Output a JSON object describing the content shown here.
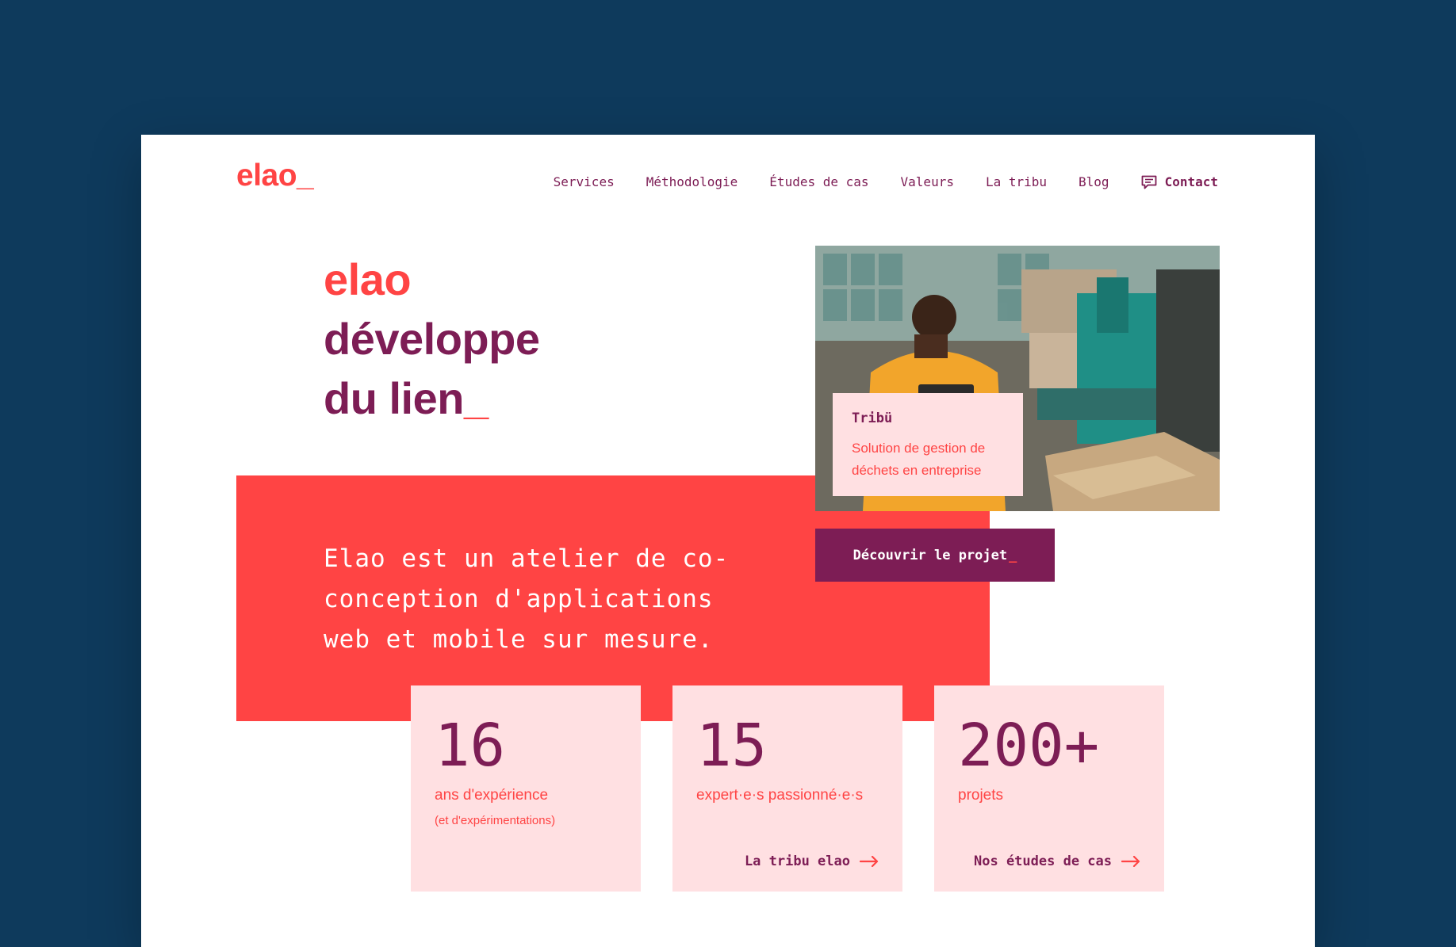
{
  "header": {
    "logo": "elao_",
    "nav": [
      "Services",
      "Méthodologie",
      "Études de cas",
      "Valeurs",
      "La tribu",
      "Blog"
    ],
    "contact_label": "Contact"
  },
  "hero": {
    "line1": "elao",
    "line2": "développe",
    "line3": "du lien",
    "line3_suffix": "_",
    "tagline": "Elao est un atelier de co-conception d'applications web et mobile sur mesure."
  },
  "project": {
    "title": "Tribü",
    "description": "Solution de gestion de déchets en entreprise",
    "cta_label": "Découvrir le projet",
    "cta_suffix": "_"
  },
  "stats": [
    {
      "number": "16",
      "label": "ans d'expérience",
      "sub": "(et d'expérimentations)",
      "link": ""
    },
    {
      "number": "15",
      "label": "expert·e·s passionné·e·s",
      "sub": "",
      "link": "La tribu elao"
    },
    {
      "number": "200+",
      "label": "projets",
      "sub": "",
      "link": "Nos études de cas"
    }
  ],
  "colors": {
    "background": "#0e3a5c",
    "accent": "#ff4444",
    "brand": "#7d1d55",
    "tint": "#ffe0e2"
  }
}
